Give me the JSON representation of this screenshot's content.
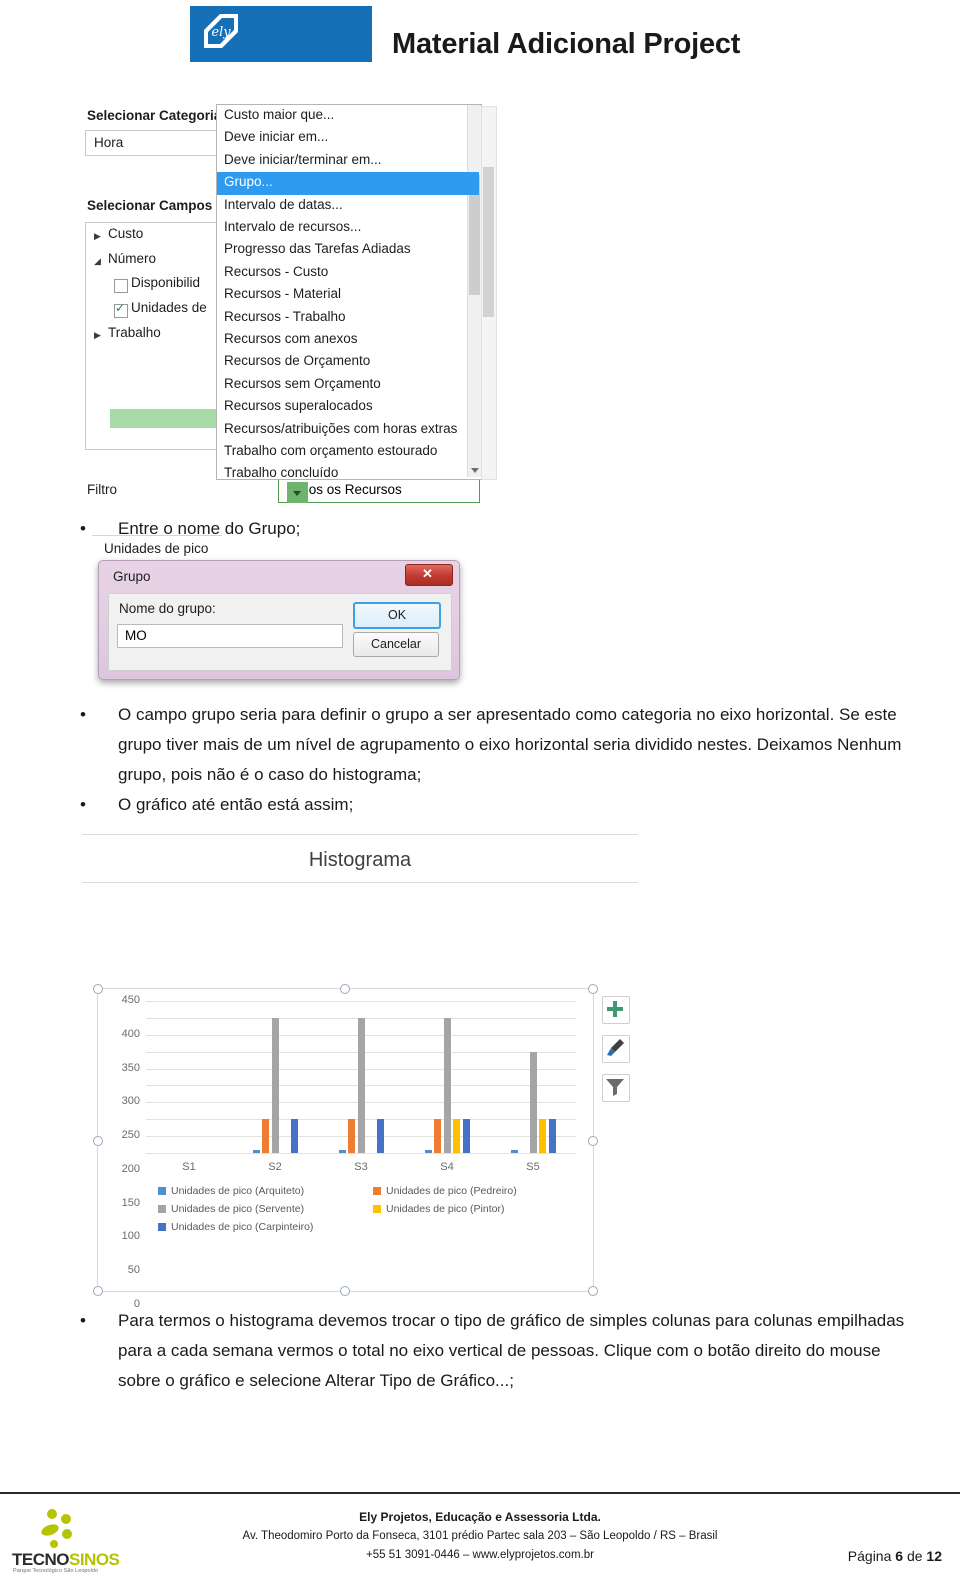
{
  "header": {
    "title": "Material Adicional Project",
    "logo_text": "ely",
    "logo_color": "#1670b8"
  },
  "field_picker": {
    "label_category": "Selecionar Categoria",
    "category_value": "Hora",
    "label_fields": "Selecionar Campos",
    "tree": [
      {
        "label": "Custo",
        "type": "group",
        "expanded": false
      },
      {
        "label": "Número",
        "type": "group",
        "expanded": true
      },
      {
        "label": "Disponibilid",
        "type": "checkbox",
        "checked": false
      },
      {
        "label": "Unidades de",
        "type": "checkbox",
        "checked": true,
        "selected": true
      },
      {
        "label": "Trabalho",
        "type": "group",
        "expanded": false
      }
    ],
    "footer_value": "Unidades de pico",
    "label_filter": "Filtro",
    "filter_value": "Todos os Recursos",
    "dropdown_items": [
      "Custo maior que...",
      "Deve iniciar em...",
      "Deve iniciar/terminar em...",
      "Grupo...",
      "Intervalo de datas...",
      "Intervalo de recursos...",
      "Progresso das Tarefas Adiadas",
      "Recursos - Custo",
      "Recursos - Material",
      "Recursos - Trabalho",
      "Recursos com anexos",
      "Recursos de Orçamento",
      "Recursos sem Orçamento",
      "Recursos superalocados",
      "Recursos/atribuições com horas extras",
      "Trabalho com orçamento estourado",
      "Trabalho concluído"
    ],
    "dropdown_selected_index": 3,
    "highlight_color": "#2e9bf0"
  },
  "bullets": {
    "b1": "Entre o nome do Grupo;",
    "b2": "O campo grupo seria para definir o grupo a ser apresentado como categoria no eixo horizontal. Se este grupo tiver mais de um nível de agrupamento o eixo horizontal seria dividido nestes. Deixamos Nenhum grupo, pois não é o caso do histograma;",
    "b3": "O gráfico até então está assim;",
    "b4": "Para termos o histograma devemos trocar o tipo de gráfico de simples colunas para colunas empilhadas para a cada semana vermos o total no eixo vertical de pessoas. Clique com o botão direito do mouse sobre o gráfico e selecione Alterar Tipo de Gráfico...;"
  },
  "grupo_dialog": {
    "title": "Grupo",
    "field_label": "Nome do grupo:",
    "field_value": "MO",
    "ok_label": "OK",
    "cancel_label": "Cancelar",
    "close_glyph": "close-icon"
  },
  "chart_tools": [
    {
      "name": "add-chart-element-button",
      "glyph": "plus-icon"
    },
    {
      "name": "chart-styles-button",
      "glyph": "paintbrush-icon"
    },
    {
      "name": "chart-filters-button",
      "glyph": "funnel-icon"
    }
  ],
  "chart_data": {
    "type": "bar",
    "title": "Histograma",
    "xlabel": "",
    "ylabel": "",
    "ylim": [
      0,
      450
    ],
    "yticks": [
      0,
      50,
      100,
      150,
      200,
      250,
      300,
      350,
      400,
      450
    ],
    "grid": true,
    "legend_position": "bottom",
    "categories": [
      "S1",
      "S2",
      "S3",
      "S4",
      "S5"
    ],
    "series": [
      {
        "name": "Unidades de pico (Arquiteto)",
        "color": "#4e8fd0",
        "values": [
          0,
          10,
          10,
          10,
          10
        ]
      },
      {
        "name": "Unidades de pico (Pedreiro)",
        "color": "#ed7d31",
        "values": [
          0,
          100,
          100,
          100,
          0
        ]
      },
      {
        "name": "Unidades de pico (Servente)",
        "color": "#a5a5a5",
        "values": [
          0,
          400,
          400,
          400,
          300
        ]
      },
      {
        "name": "Unidades de pico (Pintor)",
        "color": "#ffc000",
        "values": [
          0,
          0,
          0,
          100,
          100
        ]
      },
      {
        "name": "Unidades de pico (Carpinteiro)",
        "color": "#4472c4",
        "values": [
          0,
          100,
          100,
          100,
          100
        ]
      }
    ]
  },
  "footer": {
    "company": "Ely Projetos, Educação e Assessoria Ltda.",
    "address": "Av. Theodomiro Porto da Fonseca, 3101 prédio Partec sala 203 – São Leopoldo / RS – Brasil",
    "contact": "+55 51 3091-0446 – www.elyprojetos.com.br",
    "page_prefix": "Página ",
    "page_current": "6",
    "page_middle": " de ",
    "page_total": "12",
    "logo_word_a": "TECNO",
    "logo_word_b": "SINOS",
    "logo_sub": "Parque Tecnológico São Leopoldo"
  }
}
